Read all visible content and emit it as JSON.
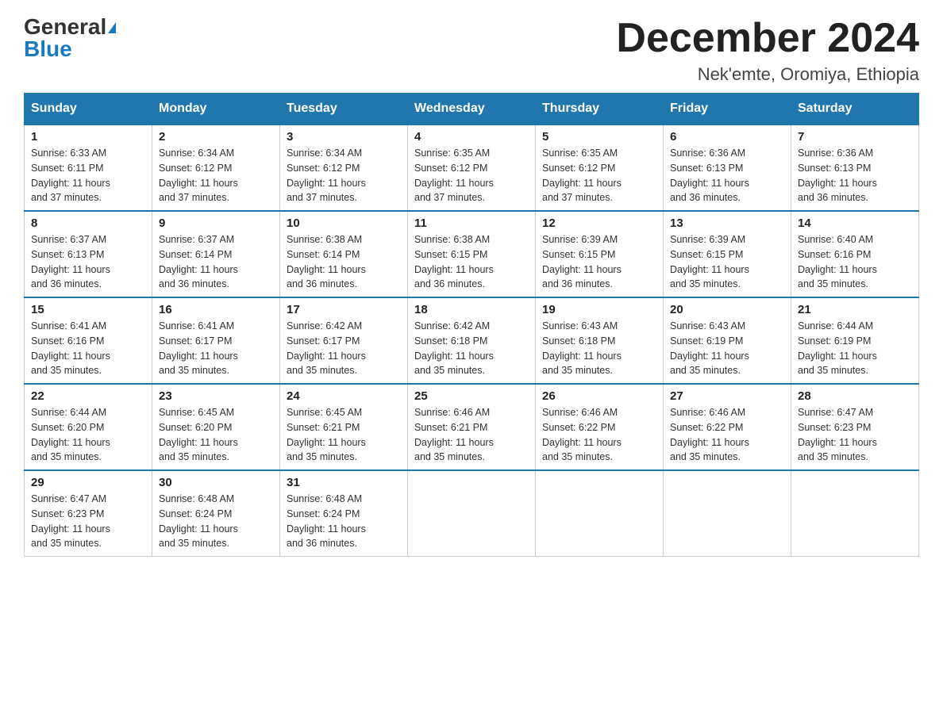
{
  "logo": {
    "general": "General",
    "blue": "Blue"
  },
  "header": {
    "month": "December 2024",
    "location": "Nek'emte, Oromiya, Ethiopia"
  },
  "days_of_week": [
    "Sunday",
    "Monday",
    "Tuesday",
    "Wednesday",
    "Thursday",
    "Friday",
    "Saturday"
  ],
  "weeks": [
    [
      {
        "day": "1",
        "sunrise": "6:33 AM",
        "sunset": "6:11 PM",
        "daylight": "11 hours and 37 minutes."
      },
      {
        "day": "2",
        "sunrise": "6:34 AM",
        "sunset": "6:12 PM",
        "daylight": "11 hours and 37 minutes."
      },
      {
        "day": "3",
        "sunrise": "6:34 AM",
        "sunset": "6:12 PM",
        "daylight": "11 hours and 37 minutes."
      },
      {
        "day": "4",
        "sunrise": "6:35 AM",
        "sunset": "6:12 PM",
        "daylight": "11 hours and 37 minutes."
      },
      {
        "day": "5",
        "sunrise": "6:35 AM",
        "sunset": "6:12 PM",
        "daylight": "11 hours and 37 minutes."
      },
      {
        "day": "6",
        "sunrise": "6:36 AM",
        "sunset": "6:13 PM",
        "daylight": "11 hours and 36 minutes."
      },
      {
        "day": "7",
        "sunrise": "6:36 AM",
        "sunset": "6:13 PM",
        "daylight": "11 hours and 36 minutes."
      }
    ],
    [
      {
        "day": "8",
        "sunrise": "6:37 AM",
        "sunset": "6:13 PM",
        "daylight": "11 hours and 36 minutes."
      },
      {
        "day": "9",
        "sunrise": "6:37 AM",
        "sunset": "6:14 PM",
        "daylight": "11 hours and 36 minutes."
      },
      {
        "day": "10",
        "sunrise": "6:38 AM",
        "sunset": "6:14 PM",
        "daylight": "11 hours and 36 minutes."
      },
      {
        "day": "11",
        "sunrise": "6:38 AM",
        "sunset": "6:15 PM",
        "daylight": "11 hours and 36 minutes."
      },
      {
        "day": "12",
        "sunrise": "6:39 AM",
        "sunset": "6:15 PM",
        "daylight": "11 hours and 36 minutes."
      },
      {
        "day": "13",
        "sunrise": "6:39 AM",
        "sunset": "6:15 PM",
        "daylight": "11 hours and 35 minutes."
      },
      {
        "day": "14",
        "sunrise": "6:40 AM",
        "sunset": "6:16 PM",
        "daylight": "11 hours and 35 minutes."
      }
    ],
    [
      {
        "day": "15",
        "sunrise": "6:41 AM",
        "sunset": "6:16 PM",
        "daylight": "11 hours and 35 minutes."
      },
      {
        "day": "16",
        "sunrise": "6:41 AM",
        "sunset": "6:17 PM",
        "daylight": "11 hours and 35 minutes."
      },
      {
        "day": "17",
        "sunrise": "6:42 AM",
        "sunset": "6:17 PM",
        "daylight": "11 hours and 35 minutes."
      },
      {
        "day": "18",
        "sunrise": "6:42 AM",
        "sunset": "6:18 PM",
        "daylight": "11 hours and 35 minutes."
      },
      {
        "day": "19",
        "sunrise": "6:43 AM",
        "sunset": "6:18 PM",
        "daylight": "11 hours and 35 minutes."
      },
      {
        "day": "20",
        "sunrise": "6:43 AM",
        "sunset": "6:19 PM",
        "daylight": "11 hours and 35 minutes."
      },
      {
        "day": "21",
        "sunrise": "6:44 AM",
        "sunset": "6:19 PM",
        "daylight": "11 hours and 35 minutes."
      }
    ],
    [
      {
        "day": "22",
        "sunrise": "6:44 AM",
        "sunset": "6:20 PM",
        "daylight": "11 hours and 35 minutes."
      },
      {
        "day": "23",
        "sunrise": "6:45 AM",
        "sunset": "6:20 PM",
        "daylight": "11 hours and 35 minutes."
      },
      {
        "day": "24",
        "sunrise": "6:45 AM",
        "sunset": "6:21 PM",
        "daylight": "11 hours and 35 minutes."
      },
      {
        "day": "25",
        "sunrise": "6:46 AM",
        "sunset": "6:21 PM",
        "daylight": "11 hours and 35 minutes."
      },
      {
        "day": "26",
        "sunrise": "6:46 AM",
        "sunset": "6:22 PM",
        "daylight": "11 hours and 35 minutes."
      },
      {
        "day": "27",
        "sunrise": "6:46 AM",
        "sunset": "6:22 PM",
        "daylight": "11 hours and 35 minutes."
      },
      {
        "day": "28",
        "sunrise": "6:47 AM",
        "sunset": "6:23 PM",
        "daylight": "11 hours and 35 minutes."
      }
    ],
    [
      {
        "day": "29",
        "sunrise": "6:47 AM",
        "sunset": "6:23 PM",
        "daylight": "11 hours and 35 minutes."
      },
      {
        "day": "30",
        "sunrise": "6:48 AM",
        "sunset": "6:24 PM",
        "daylight": "11 hours and 35 minutes."
      },
      {
        "day": "31",
        "sunrise": "6:48 AM",
        "sunset": "6:24 PM",
        "daylight": "11 hours and 36 minutes."
      },
      null,
      null,
      null,
      null
    ]
  ],
  "labels": {
    "sunrise": "Sunrise:",
    "sunset": "Sunset:",
    "daylight": "Daylight:"
  }
}
